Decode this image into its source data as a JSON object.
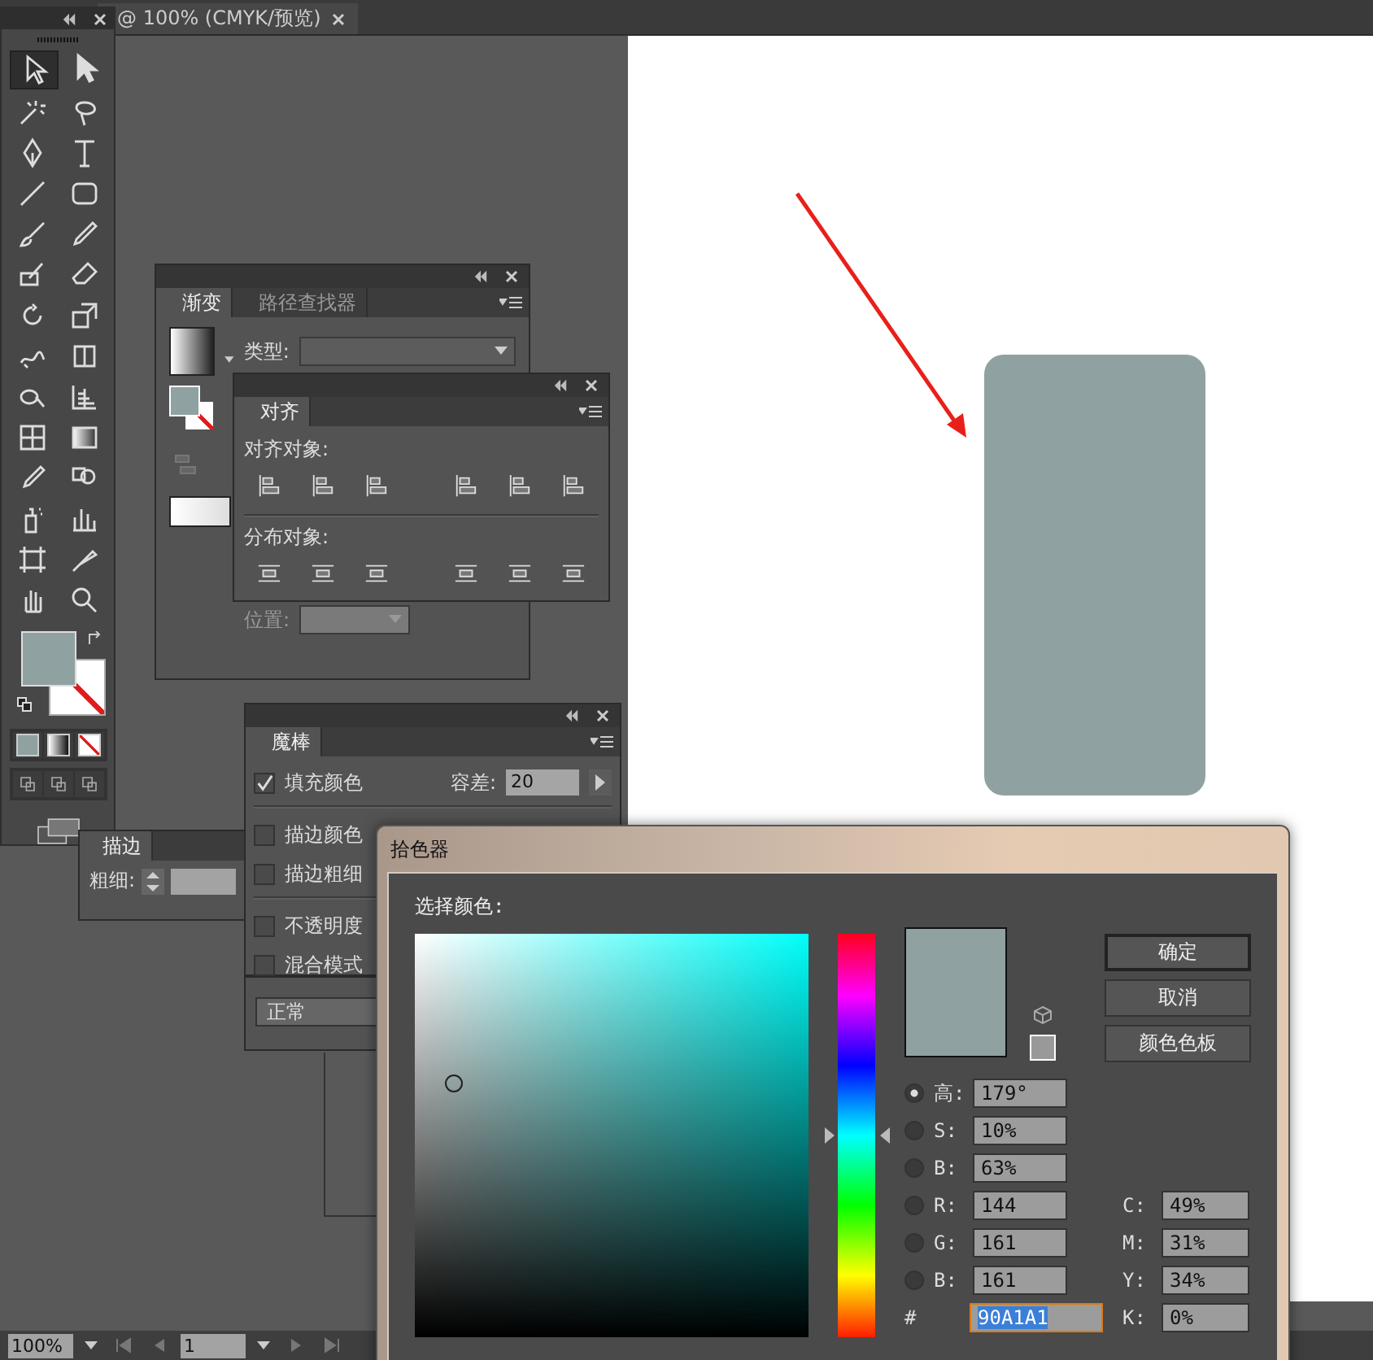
{
  "document_tab": {
    "title": "@ 100% (CMYK/预览)"
  },
  "gradient_panel": {
    "tabs": [
      {
        "label": "渐变",
        "selected": true
      },
      {
        "label": "路径查找器",
        "selected": false
      }
    ],
    "type_label": "类型:",
    "position_label": "位置:"
  },
  "align_panel": {
    "tabs": [
      {
        "label": "对齐",
        "selected": true
      }
    ],
    "align_label": "对齐对象:",
    "distribute_label": "分布对象:"
  },
  "stroke_panel": {
    "tabs": [
      {
        "label": "描边",
        "selected": true
      }
    ],
    "weight_label": "粗细:"
  },
  "transparency_panel": {
    "blend_mode": "正常"
  },
  "magic_wand_panel": {
    "tabs": [
      {
        "label": "魔棒",
        "selected": true
      }
    ],
    "tolerance_label": "容差:",
    "tolerance": "20",
    "groups": [
      [
        {
          "label": "填充颜色",
          "checked": true
        }
      ],
      [
        {
          "label": "描边颜色",
          "checked": false
        },
        {
          "label": "描边粗细",
          "checked": false
        }
      ],
      [
        {
          "label": "不透明度",
          "checked": false
        },
        {
          "label": "混合模式",
          "checked": false
        }
      ]
    ]
  },
  "color_picker": {
    "title": "拾色器",
    "prompt": "选择颜色:",
    "buttons": [
      {
        "label": "确定",
        "default": true
      },
      {
        "label": "取消",
        "default": false
      },
      {
        "label": "颜色色板",
        "default": false
      }
    ],
    "hsb_rgb": [
      {
        "label": "高:",
        "value": "179°",
        "selected": true
      },
      {
        "label": "S:",
        "value": "10%",
        "selected": false
      },
      {
        "label": "B:",
        "value": "63%",
        "selected": false
      },
      {
        "label": "R:",
        "value": "144",
        "selected": false
      },
      {
        "label": "G:",
        "value": "161",
        "selected": false
      },
      {
        "label": "B:",
        "value": "161",
        "selected": false
      }
    ],
    "cmyk": [
      {
        "label": "C:",
        "value": "49%"
      },
      {
        "label": "M:",
        "value": "31%"
      },
      {
        "label": "Y:",
        "value": "34%"
      },
      {
        "label": "K:",
        "value": "0%"
      }
    ],
    "hex_label": "#",
    "hex": "90A1A1",
    "hue_slider": {
      "level": 0.5
    }
  },
  "status_bar": {
    "zoom": "100%",
    "page": "1"
  }
}
